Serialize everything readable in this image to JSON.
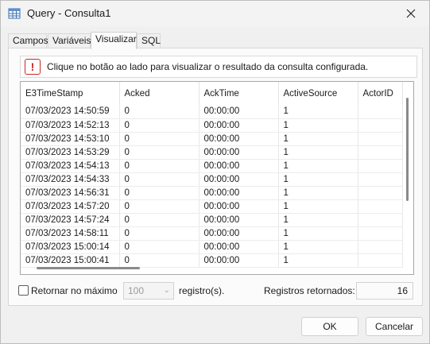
{
  "window": {
    "title": "Query - Consulta1"
  },
  "tabs": [
    {
      "label": "Campos"
    },
    {
      "label": "Variáveis"
    },
    {
      "label": "Visualizar",
      "active": true
    },
    {
      "label": "SQL"
    }
  ],
  "info": {
    "icon": "warning-icon",
    "text": "Clique no botão ao lado para visualizar o resultado da consulta configurada."
  },
  "grid": {
    "columns": [
      "E3TimeStamp",
      "Acked",
      "AckTime",
      "ActiveSource",
      "ActorID"
    ],
    "rows": [
      [
        "07/03/2023 14:50:59",
        "0",
        "00:00:00",
        "1",
        ""
      ],
      [
        "07/03/2023 14:52:13",
        "0",
        "00:00:00",
        "1",
        ""
      ],
      [
        "07/03/2023 14:53:10",
        "0",
        "00:00:00",
        "1",
        ""
      ],
      [
        "07/03/2023 14:53:29",
        "0",
        "00:00:00",
        "1",
        ""
      ],
      [
        "07/03/2023 14:54:13",
        "0",
        "00:00:00",
        "1",
        ""
      ],
      [
        "07/03/2023 14:54:33",
        "0",
        "00:00:00",
        "1",
        ""
      ],
      [
        "07/03/2023 14:56:31",
        "0",
        "00:00:00",
        "1",
        ""
      ],
      [
        "07/03/2023 14:57:20",
        "0",
        "00:00:00",
        "1",
        ""
      ],
      [
        "07/03/2023 14:57:24",
        "0",
        "00:00:00",
        "1",
        ""
      ],
      [
        "07/03/2023 14:58:11",
        "0",
        "00:00:00",
        "1",
        ""
      ],
      [
        "07/03/2023 15:00:14",
        "0",
        "00:00:00",
        "1",
        ""
      ],
      [
        "07/03/2023 15:00:41",
        "0",
        "00:00:00",
        "1",
        ""
      ]
    ]
  },
  "options": {
    "limit_label": "Retornar no máximo",
    "limit_checked": false,
    "limit_value": "100",
    "registros_label": "registro(s).",
    "returned_label": "Registros retornados:",
    "returned_value": "16"
  },
  "buttons": {
    "ok": "OK",
    "cancel": "Cancelar"
  },
  "colors": {
    "warning": "#c62828",
    "window_bg": "#f0f0f0"
  }
}
